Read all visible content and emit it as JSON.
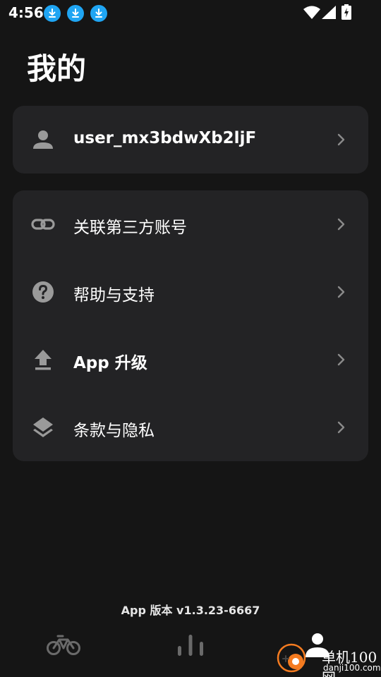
{
  "status_bar": {
    "time": "4:56",
    "download_notifications": [
      "download-icon",
      "download-icon",
      "download-icon"
    ],
    "right_icons": [
      "wifi-icon",
      "signal-icon",
      "battery-charging-icon"
    ]
  },
  "page": {
    "title": "我的"
  },
  "user": {
    "username": "user_mx3bdwXb2ljF",
    "icon": "person-icon"
  },
  "menu": {
    "items": [
      {
        "label": "关联第三方账号",
        "icon": "link-icon"
      },
      {
        "label": "帮助与支持",
        "icon": "help-icon"
      },
      {
        "label": "App 升级",
        "icon": "upload-icon"
      },
      {
        "label": "条款与隐私",
        "icon": "layers-icon"
      }
    ]
  },
  "version": {
    "text": "App 版本 v1.3.23-6667"
  },
  "bottom_nav": {
    "items": [
      {
        "icon": "bike-icon",
        "active": false
      },
      {
        "icon": "stats-icon",
        "active": false
      },
      {
        "icon": "profile-icon",
        "active": true
      }
    ]
  },
  "watermark": {
    "name": "单机100网",
    "url": "danji100.com"
  },
  "colors": {
    "background": "#151515",
    "card": "#232325",
    "icon_gray": "#9a9a9a",
    "chevron": "#8a8a8a",
    "download_badge": "#1fa5f3",
    "nav_inactive": "#6a6a6a",
    "nav_active": "#ffffff"
  }
}
